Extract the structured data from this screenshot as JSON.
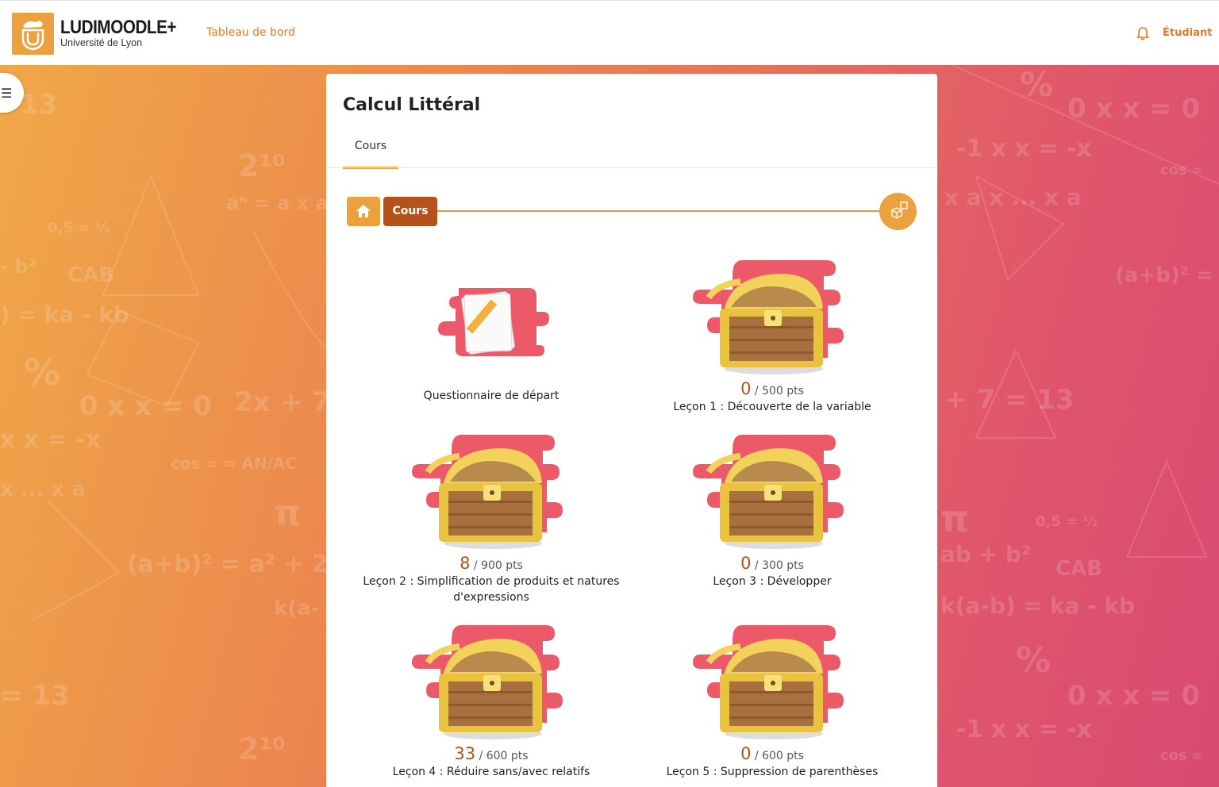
{
  "header": {
    "brand_title": "LUDIMOODLE+",
    "brand_subtitle": "Université de Lyon",
    "nav_link": "Tableau de bord",
    "user_label": "Étudiant"
  },
  "course": {
    "title": "Calcul Littéral",
    "tabs": [
      {
        "label": "Cours"
      }
    ]
  },
  "breadcrumb": {
    "current": "Cours"
  },
  "items": [
    {
      "label": "Questionnaire de départ",
      "type": "quiz"
    },
    {
      "label": "Leçon 1 : Découverte de la variable",
      "score": "0",
      "max": "/ 500 pts",
      "type": "chest"
    },
    {
      "label": "Leçon 2 : Simplification de produits et natures d'expressions",
      "score": "8",
      "max": "/ 900 pts",
      "type": "chest"
    },
    {
      "label": "Leçon 3 : Développer",
      "score": "0",
      "max": "/ 300 pts",
      "type": "chest"
    },
    {
      "label": "Leçon 4 : Réduire sans/avec relatifs",
      "score": "33",
      "max": "/ 600 pts",
      "type": "chest"
    },
    {
      "label": "Leçon 5 : Suppression de parenthèses",
      "score": "0",
      "max": "/ 600 pts",
      "type": "chest"
    }
  ],
  "icons": {
    "logo": "lion-shield-logo",
    "bell": "bell-icon",
    "drawer": "list-icon",
    "home": "home-icon",
    "level_end": "cube-icon"
  },
  "colors": {
    "accent": "#eba13e",
    "accent_dark": "#b5521c",
    "link": "#e07a2c",
    "blob": "#ec5a69"
  }
}
